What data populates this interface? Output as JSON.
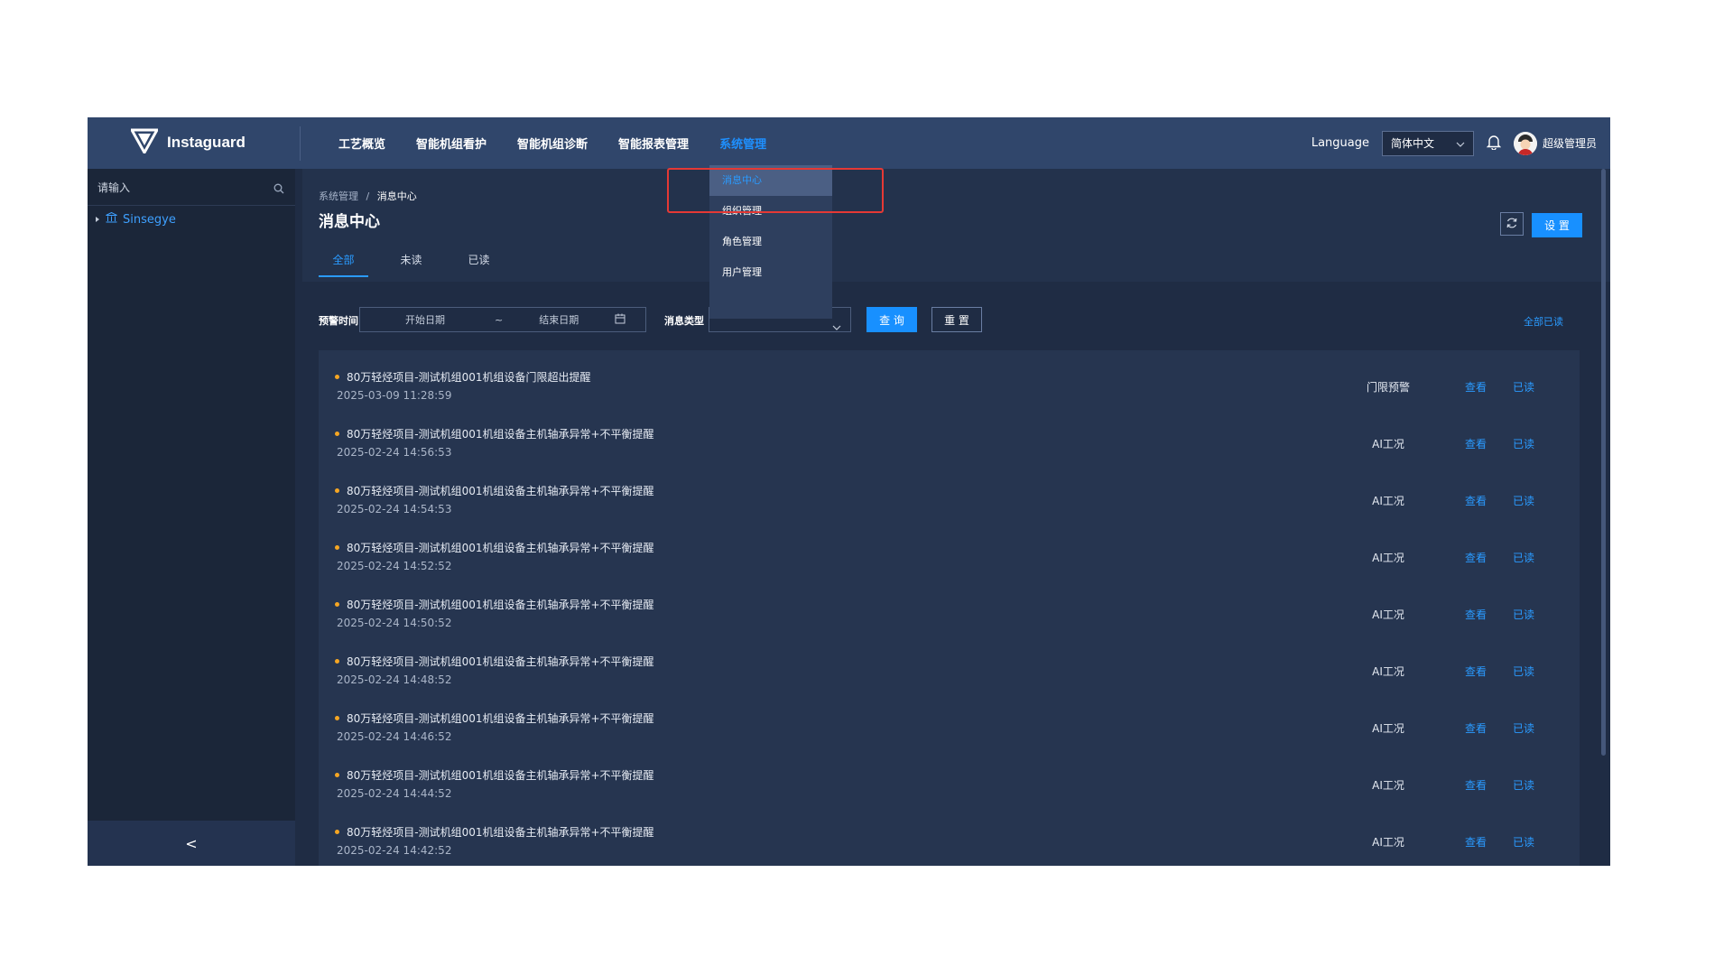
{
  "topbar": {
    "brand": "Instaguard",
    "nav": [
      "工艺概览",
      "智能机组看护",
      "智能机组诊断",
      "智能报表管理",
      "系统管理"
    ],
    "active_nav_index": 4,
    "language_label": "Language",
    "language_value": "简体中文",
    "user_name": "超级管理员"
  },
  "sidebar": {
    "search_placeholder": "请输入",
    "tree_item": "Sinsegye",
    "collapse_glyph": "<"
  },
  "dropdown": {
    "items": [
      "消息中心",
      "组织管理",
      "角色管理",
      "用户管理"
    ],
    "active_index": 0
  },
  "header": {
    "breadcrumb_parent": "系统管理",
    "breadcrumb_sep": "/",
    "breadcrumb_current": "消息中心",
    "title": "消息中心",
    "tabs": [
      "全部",
      "未读",
      "已读"
    ],
    "active_tab": 0,
    "settings_label": "设 置"
  },
  "filters": {
    "time_label": "预警时间",
    "start_placeholder": "开始日期",
    "range_sep": "~",
    "end_placeholder": "结束日期",
    "type_label": "消息类型",
    "query_label": "查 询",
    "reset_label": "重 置",
    "mark_all_label": "全部已读"
  },
  "messages": [
    {
      "title": "80万轻烃项目-测试机组001机组设备门限超出提醒",
      "time": "2025-03-09 11:28:59",
      "type": "门限预警",
      "view": "查看",
      "read": "已读"
    },
    {
      "title": "80万轻烃项目-测试机组001机组设备主机轴承异常+不平衡提醒",
      "time": "2025-02-24 14:56:53",
      "type": "AI工况",
      "view": "查看",
      "read": "已读"
    },
    {
      "title": "80万轻烃项目-测试机组001机组设备主机轴承异常+不平衡提醒",
      "time": "2025-02-24 14:54:53",
      "type": "AI工况",
      "view": "查看",
      "read": "已读"
    },
    {
      "title": "80万轻烃项目-测试机组001机组设备主机轴承异常+不平衡提醒",
      "time": "2025-02-24 14:52:52",
      "type": "AI工况",
      "view": "查看",
      "read": "已读"
    },
    {
      "title": "80万轻烃项目-测试机组001机组设备主机轴承异常+不平衡提醒",
      "time": "2025-02-24 14:50:52",
      "type": "AI工况",
      "view": "查看",
      "read": "已读"
    },
    {
      "title": "80万轻烃项目-测试机组001机组设备主机轴承异常+不平衡提醒",
      "time": "2025-02-24 14:48:52",
      "type": "AI工况",
      "view": "查看",
      "read": "已读"
    },
    {
      "title": "80万轻烃项目-测试机组001机组设备主机轴承异常+不平衡提醒",
      "time": "2025-02-24 14:46:52",
      "type": "AI工况",
      "view": "查看",
      "read": "已读"
    },
    {
      "title": "80万轻烃项目-测试机组001机组设备主机轴承异常+不平衡提醒",
      "time": "2025-02-24 14:44:52",
      "type": "AI工况",
      "view": "查看",
      "read": "已读"
    },
    {
      "title": "80万轻烃项目-测试机组001机组设备主机轴承异常+不平衡提醒",
      "time": "2025-02-24 14:42:52",
      "type": "AI工况",
      "view": "查看",
      "read": "已读"
    }
  ],
  "colors": {
    "accent": "#1890ff",
    "topbar": "#30466b",
    "background": "#1f2c44",
    "highlight": "#e53935",
    "dot": "#f5a623"
  },
  "icons": [
    "logo-icon",
    "search-icon",
    "tree-arrow-icon",
    "building-icon",
    "bell-icon",
    "chevron-down-icon",
    "calendar-icon",
    "refresh-icon"
  ]
}
